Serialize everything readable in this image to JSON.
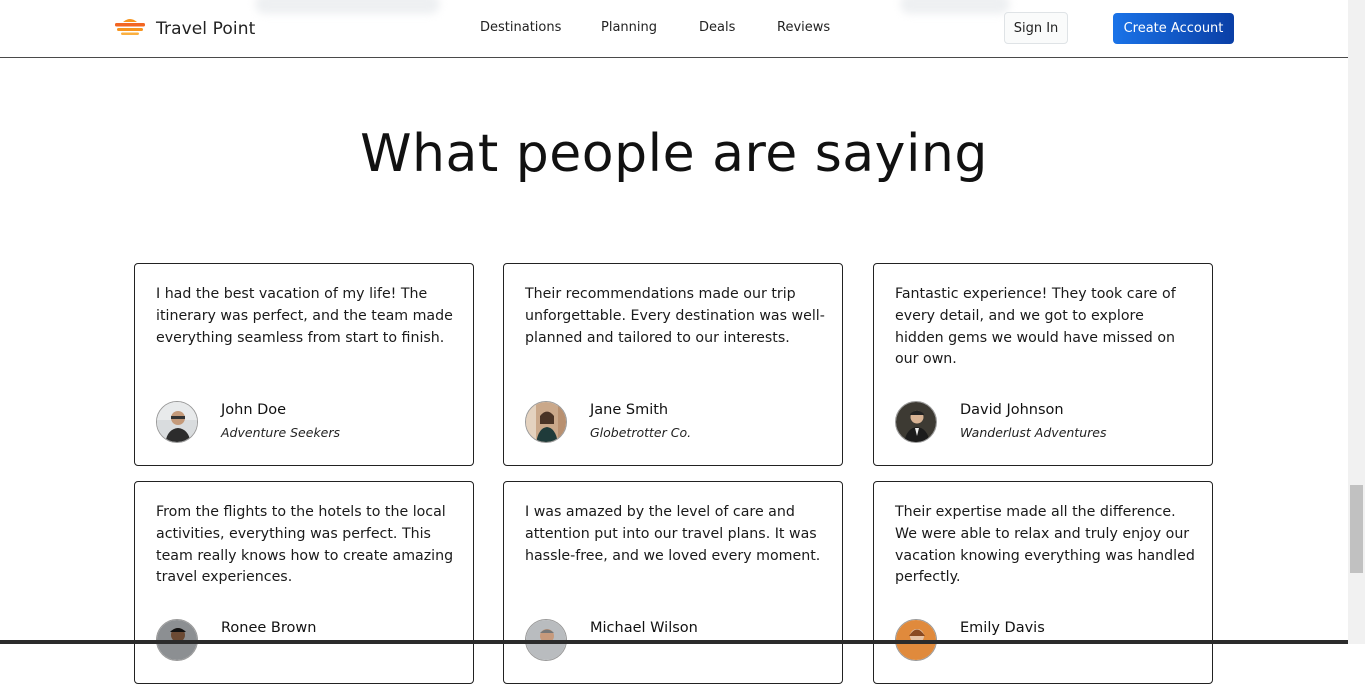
{
  "header": {
    "brand_name": "Travel Point",
    "nav": [
      "Destinations",
      "Planning",
      "Deals",
      "Reviews"
    ],
    "sign_in_label": "Sign In",
    "create_account_label": "Create Account"
  },
  "section": {
    "title": "What people are saying"
  },
  "testimonials": [
    {
      "quote": "I had the best vacation of my life! The itinerary was perfect, and the team made everything seamless from start to finish.",
      "name": "John Doe",
      "company": "Adventure Seekers"
    },
    {
      "quote": "Their recommendations made our trip unforgettable. Every destination was well-planned and tailored to our interests.",
      "name": "Jane Smith",
      "company": "Globetrotter Co."
    },
    {
      "quote": "Fantastic experience! They took care of every detail, and we got to explore hidden gems we would have missed on our own.",
      "name": "David Johnson",
      "company": "Wanderlust Adventures"
    },
    {
      "quote": "From the flights to the hotels to the local activities, everything was perfect. This team really knows how to create amazing travel experiences.",
      "name": "Ronee Brown",
      "company": ""
    },
    {
      "quote": "I was amazed by the level of care and attention put into our travel plans. It was hassle-free, and we loved every moment.",
      "name": "Michael Wilson",
      "company": ""
    },
    {
      "quote": "Their expertise made all the difference. We were able to relax and truly enjoy our vacation knowing everything was handled perfectly.",
      "name": "Emily Davis",
      "company": ""
    }
  ]
}
